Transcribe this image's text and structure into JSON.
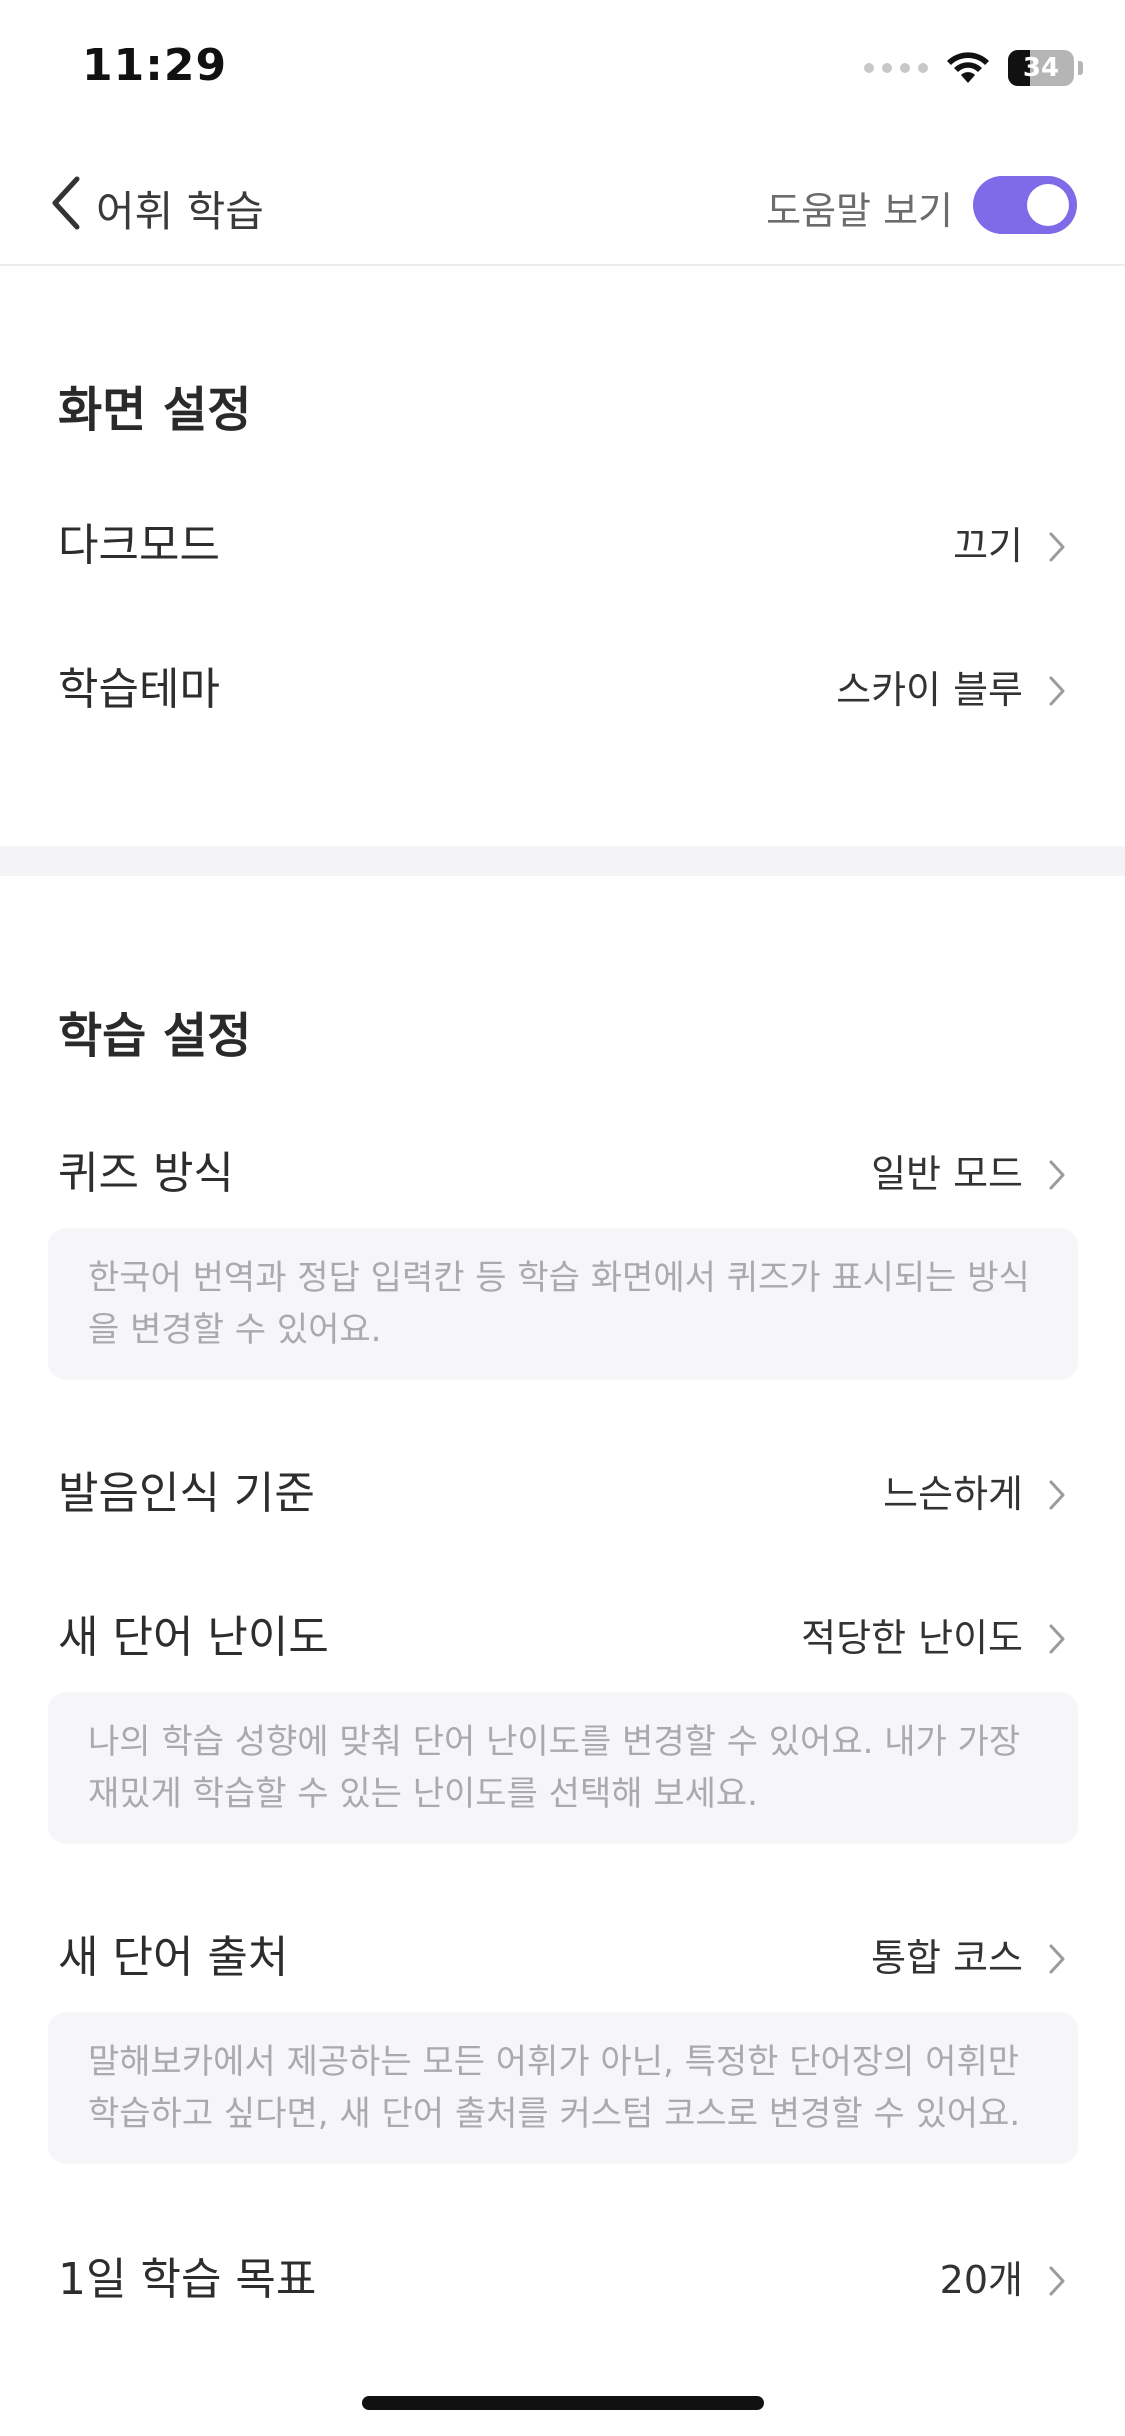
{
  "status_bar": {
    "time": "11:29",
    "battery_level": "34",
    "battery_fraction": 0.34
  },
  "header": {
    "title": "어휘 학습",
    "help_label": "도움말 보기",
    "help_toggle_on": true,
    "accent_color": "#7f6ae8"
  },
  "display_settings": {
    "title": "화면 설정",
    "dark_mode": {
      "label": "다크모드",
      "value": "끄기"
    },
    "theme": {
      "label": "학습테마",
      "value": "스카이 블루"
    }
  },
  "study_settings": {
    "title": "학습 설정",
    "quiz_mode": {
      "label": "퀴즈 방식",
      "value": "일반 모드",
      "description": "한국어 번역과 정답 입력칸 등 학습 화면에서 퀴즈가 표시되는 방식을 변경할 수 있어요."
    },
    "pronunciation": {
      "label": "발음인식 기준",
      "value": "느슨하게"
    },
    "difficulty": {
      "label": "새 단어 난이도",
      "value": "적당한 난이도",
      "description": "나의 학습 성향에 맞춰 단어 난이도를 변경할 수 있어요. 내가 가장 재밌게 학습할 수 있는 난이도를 선택해 보세요."
    },
    "source": {
      "label": "새 단어 출처",
      "value": "통합 코스",
      "description": "말해보카에서 제공하는 모든 어휘가 아닌, 특정한 단어장의 어휘만 학습하고 싶다면, 새 단어 출처를 커스텀 코스로 변경할 수 있어요."
    },
    "daily_goal": {
      "label": "1일 학습 목표",
      "value": "20개"
    }
  }
}
